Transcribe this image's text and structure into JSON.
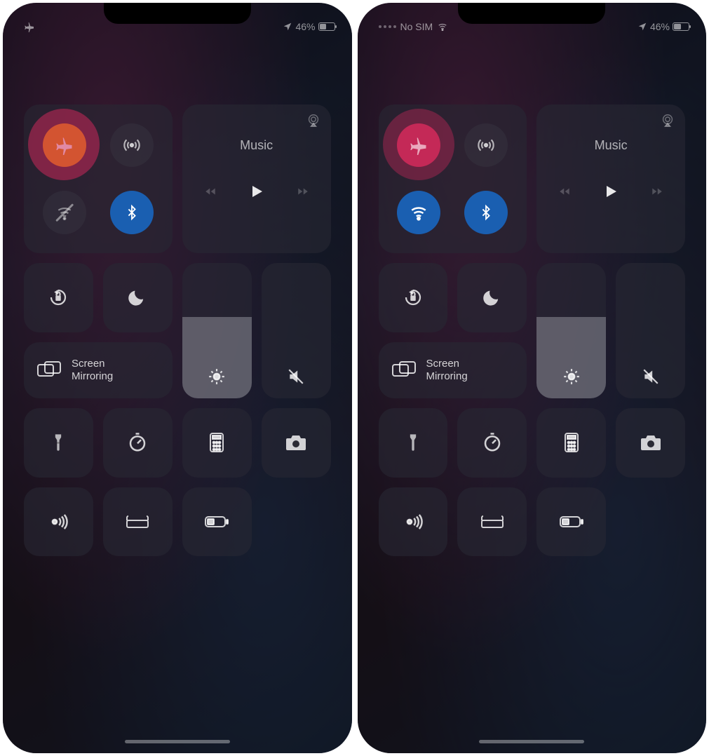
{
  "left": {
    "status": {
      "carrier": "",
      "battery_text": "46%"
    },
    "music": {
      "title": "Music"
    },
    "mirror": {
      "line1": "Screen",
      "line2": "Mirroring"
    },
    "airplane_on": true,
    "wifi_on": false
  },
  "right": {
    "status": {
      "carrier": "No SIM",
      "battery_text": "46%"
    },
    "music": {
      "title": "Music"
    },
    "mirror": {
      "line1": "Screen",
      "line2": "Mirroring"
    },
    "airplane_on": false,
    "wifi_on": true
  }
}
